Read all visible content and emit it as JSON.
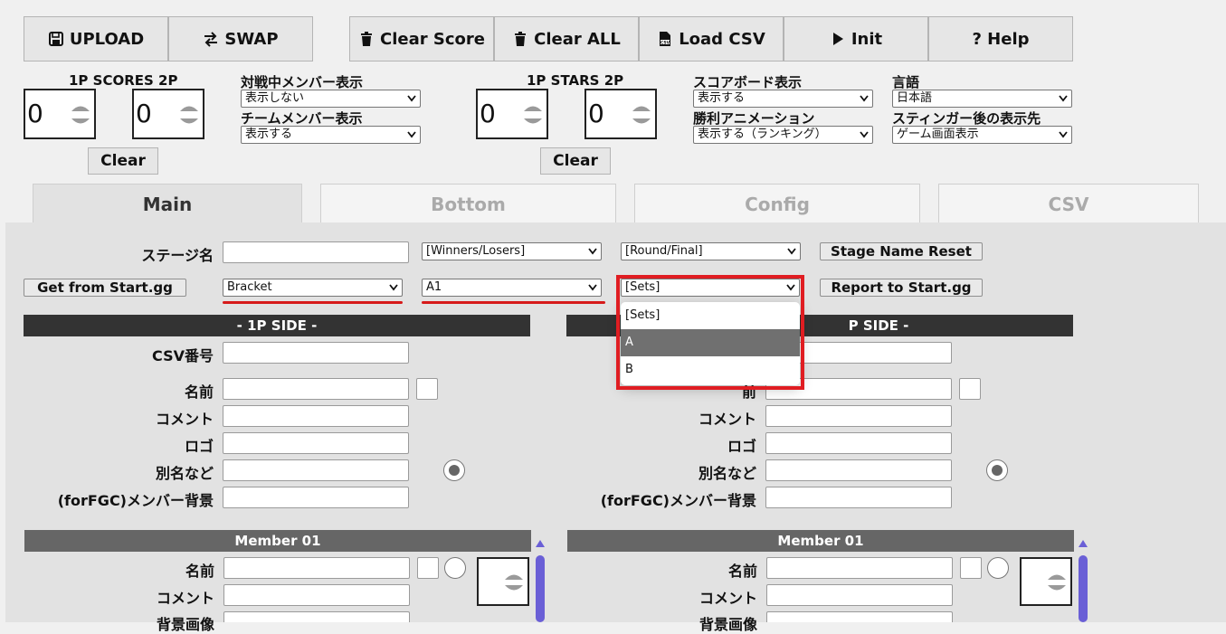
{
  "toolbar": {
    "upload": "UPLOAD",
    "swap": "SWAP",
    "clear_score": "Clear Score",
    "clear_all": "Clear ALL",
    "load_csv": "Load CSV",
    "init": "Init",
    "help": "? Help"
  },
  "scores": {
    "label": "1P SCORES 2P",
    "p1": "0",
    "p2": "0",
    "clear": "Clear"
  },
  "stars": {
    "label": "1P STARS 2P",
    "p1": "0",
    "p2": "0",
    "clear": "Clear"
  },
  "options": {
    "current_member_label": "対戦中メンバー表示",
    "current_member_value": "表示しない",
    "team_member_label": "チームメンバー表示",
    "team_member_value": "表示する",
    "scoreboard_label": "スコアボード表示",
    "scoreboard_value": "表示する",
    "win_anim_label": "勝利アニメーション",
    "win_anim_value": "表示する（ランキング）",
    "language_label": "言語",
    "language_value": "日本語",
    "stinger_label": "スティンガー後の表示先",
    "stinger_value": "ゲーム画面表示"
  },
  "tabs": [
    "Main",
    "Bottom",
    "Config",
    "CSV"
  ],
  "stage": {
    "label": "ステージ名",
    "value": "",
    "winners_losers": "[Winners/Losers]",
    "round_final": "[Round/Final]",
    "reset": "Stage Name Reset"
  },
  "startgg": {
    "get": "Get from Start.gg",
    "bracket": "Bracket",
    "pool": "A1",
    "sets": "[Sets]",
    "report": "Report to Start.gg"
  },
  "dropdown": {
    "options": [
      "[Sets]",
      "A",
      "B"
    ]
  },
  "side1": {
    "header": "- 1P SIDE -",
    "csv_label": "CSV番号",
    "name_label": "名前",
    "comment_label": "コメント",
    "logo_label": "ロゴ",
    "alias_label": "別名など",
    "bg_label": "(forFGC)メンバー背景"
  },
  "side2": {
    "header_visible": "P SIDE -",
    "name_label_visible": "前",
    "comment_label": "コメント",
    "logo_label": "ロゴ",
    "alias_label": "別名など",
    "bg_label": "(forFGC)メンバー背景"
  },
  "member1": {
    "header": "Member 01",
    "name_label": "名前",
    "comment_label": "コメント",
    "bg_label": "背景画像"
  },
  "member2": {
    "header": "Member 01",
    "name_label": "名前",
    "comment_label": "コメント",
    "bg_label": "背景画像"
  }
}
